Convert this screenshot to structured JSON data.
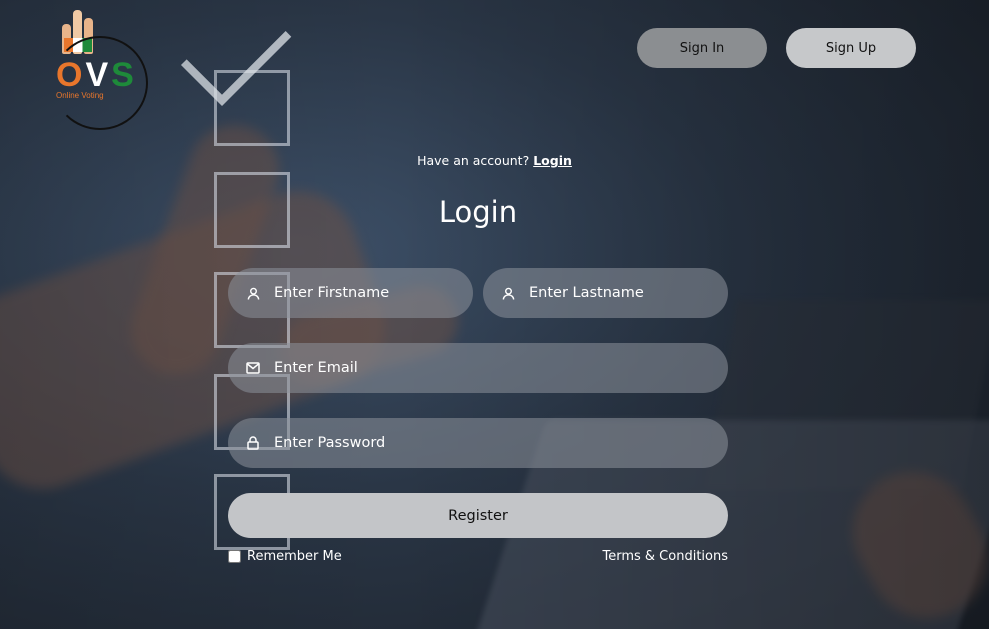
{
  "logo": {
    "letters": [
      "O",
      "V",
      "S"
    ],
    "subtitle": "Online Voting"
  },
  "nav": {
    "sign_in": "Sign In",
    "sign_up": "Sign Up"
  },
  "prompt": {
    "text": "Have an account?",
    "link": "Login"
  },
  "form": {
    "title": "Login",
    "firstname": {
      "placeholder": "Enter Firstname",
      "icon": "user-icon"
    },
    "lastname": {
      "placeholder": "Enter Lastname",
      "icon": "user-icon"
    },
    "email": {
      "placeholder": "Enter Email",
      "icon": "envelope-icon"
    },
    "password": {
      "placeholder": "Enter Password",
      "icon": "lock-icon"
    },
    "submit": "Register",
    "remember": "Remember Me",
    "terms": "Terms & Conditions"
  },
  "colors": {
    "logo_orange": "#e8762c",
    "logo_green": "#1e8a3a",
    "field_bg": "#8c929b"
  }
}
